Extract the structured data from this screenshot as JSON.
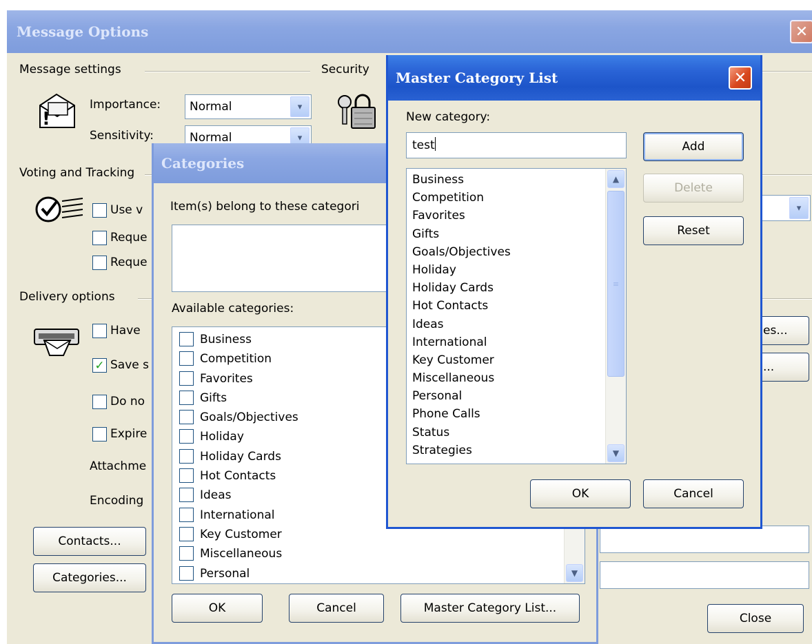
{
  "message_options": {
    "title": "Message Options",
    "close_glyph": "✕",
    "message_settings": {
      "title": "Message settings",
      "importance_label": "Importance:",
      "importance_value": "Normal",
      "sensitivity_label": "Sensitivity:",
      "sensitivity_value": "Normal"
    },
    "security": {
      "title": "Security"
    },
    "voting": {
      "title": "Voting and Tracking",
      "use_voting": "Use v",
      "request_1": "Reque",
      "request_2": "Reque"
    },
    "delivery": {
      "title": "Delivery options",
      "have": "Have",
      "save": "Save s",
      "do_not": "Do no",
      "expire": "Expire",
      "attachments": "Attachme",
      "encoding": "Encoding",
      "select_names_tail": "es...",
      "browse_tail": "..."
    },
    "contacts_button": "Contacts...",
    "categories_button": "Categories...",
    "close_button": "Close"
  },
  "categories_dialog": {
    "title": "Categories",
    "belong_label": "Item(s) belong to these categori",
    "available_label": "Available categories:",
    "items": [
      "Business",
      "Competition",
      "Favorites",
      "Gifts",
      "Goals/Objectives",
      "Holiday",
      "Holiday Cards",
      "Hot Contacts",
      "Ideas",
      "International",
      "Key Customer",
      "Miscellaneous",
      "Personal"
    ],
    "ok": "OK",
    "cancel": "Cancel",
    "master_list_button": "Master Category List..."
  },
  "master_dialog": {
    "title": "Master Category List",
    "close_glyph": "✕",
    "new_category_label": "New category:",
    "new_category_value": "test",
    "items": [
      "Business",
      "Competition",
      "Favorites",
      "Gifts",
      "Goals/Objectives",
      "Holiday",
      "Holiday Cards",
      "Hot Contacts",
      "Ideas",
      "International",
      "Key Customer",
      "Miscellaneous",
      "Personal",
      "Phone Calls",
      "Status",
      "Strategies"
    ],
    "add": "Add",
    "delete": "Delete",
    "reset": "Reset",
    "ok": "OK",
    "cancel": "Cancel"
  },
  "glyphs": {
    "combo_arrow": "▾",
    "scroll_up": "▲",
    "scroll_down": "▼",
    "thumb_grip": "≡",
    "checkmark": "✓"
  },
  "icons": [
    "envelope-importance-icon",
    "security-keys-lock-icon",
    "voting-check-icon",
    "delivery-envelope-icon"
  ]
}
